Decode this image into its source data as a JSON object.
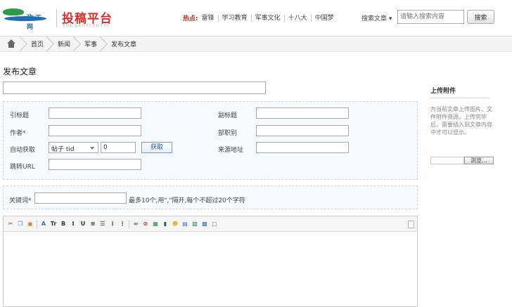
{
  "header": {
    "logo_text": "投稿平台",
    "logo_sub": "TOUGAOPINGTAI",
    "logo_mark_text": "政 工 网",
    "hot_label": "热点:",
    "hot_links": [
      "雷锋",
      "学习教育",
      "军事文化",
      "十八大",
      "中国梦"
    ],
    "search_type": "搜索文章 ▾",
    "search_placeholder": "请输入搜索内容",
    "search_button": "搜索"
  },
  "breadcrumb": [
    "首页",
    "新闻",
    "军事",
    "发布文章"
  ],
  "page_title": "发布文章",
  "form": {
    "left_labels": [
      "引标题",
      "作者*",
      "自动获取",
      "跳转URL"
    ],
    "right_labels": [
      "副标题",
      "部职别",
      "来源地址"
    ],
    "autofetch_select": "帖子 tid",
    "autofetch_value": "0",
    "fetch_button": "获取",
    "keyword_label": "关键词*",
    "keyword_hint": "最多10个,用\",\"隔开,每个不超过20个字符"
  },
  "sidebar": {
    "title": "上传附件",
    "description": "为当前文章上传图片、文件附件资源。上传完毕后，需要插入到文章内容中才可以显示。",
    "browse_button": "浏览..."
  },
  "toolbar_icons": [
    {
      "name": "cut-icon",
      "glyph": "✂",
      "color": "#c0392b"
    },
    {
      "name": "copy-icon",
      "glyph": "❐",
      "color": "#5b7fb5"
    },
    {
      "name": "paste-icon",
      "glyph": "▣",
      "color": "#c08a2b"
    },
    {
      "name": "sep"
    },
    {
      "name": "font-family-icon",
      "glyph": "A",
      "color": "#3a6fb0"
    },
    {
      "name": "font-size-icon",
      "glyph": "Tr",
      "color": "#333"
    },
    {
      "name": "bold-icon",
      "glyph": "B",
      "color": "#333"
    },
    {
      "name": "italic-icon",
      "glyph": "I",
      "color": "#333"
    },
    {
      "name": "underline-icon",
      "glyph": "U",
      "color": "#333"
    },
    {
      "name": "align-center-icon",
      "glyph": "≡",
      "color": "#333"
    },
    {
      "name": "align-right-icon",
      "glyph": "☰",
      "color": "#333"
    },
    {
      "name": "unordered-list-icon",
      "glyph": "⁝",
      "color": "#333"
    },
    {
      "name": "ordered-list-icon",
      "glyph": "⋮",
      "color": "#333"
    },
    {
      "name": "sep"
    },
    {
      "name": "link-icon",
      "glyph": "∞",
      "color": "#555"
    },
    {
      "name": "unlink-icon",
      "glyph": "⊘",
      "color": "#b03030"
    },
    {
      "name": "image-icon",
      "glyph": "▦",
      "color": "#2e8a4a"
    },
    {
      "name": "flash-icon",
      "glyph": "▮",
      "color": "#2e6a2e"
    },
    {
      "name": "emoticon-icon",
      "glyph": "☻",
      "color": "#e0b020"
    },
    {
      "name": "table-icon",
      "glyph": "▤",
      "color": "#3a6fb0"
    },
    {
      "name": "insert-code-icon",
      "glyph": "▧",
      "color": "#2e7a4a"
    },
    {
      "name": "save-icon",
      "glyph": "▩",
      "color": "#3a6fb0"
    },
    {
      "name": "fullscreen-icon",
      "glyph": "▢",
      "color": "#777"
    }
  ]
}
